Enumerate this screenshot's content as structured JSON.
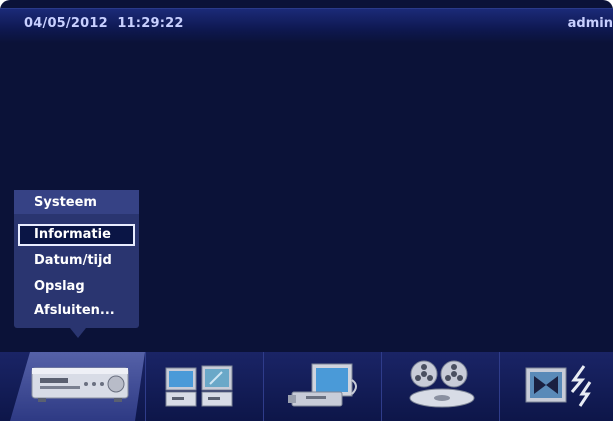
{
  "status": {
    "date": "04/05/2012",
    "time": "11:29:22",
    "user": "admin"
  },
  "menu": {
    "title": "Systeem",
    "items": [
      {
        "label": "Informatie",
        "selected": true
      },
      {
        "label": "Datum/tijd",
        "selected": false
      },
      {
        "label": "Opslag",
        "selected": false
      },
      {
        "label": "Afsluiten...",
        "selected": false
      }
    ]
  },
  "taskbar": {
    "icons": [
      {
        "name": "dvr-system-icon",
        "active": true
      },
      {
        "name": "multi-camera-display-icon",
        "active": false
      },
      {
        "name": "monitor-usb-storage-icon",
        "active": false
      },
      {
        "name": "film-reel-playback-icon",
        "active": false
      },
      {
        "name": "alarm-lightning-icon",
        "active": false
      }
    ]
  },
  "colors": {
    "background": "#0b1238",
    "menu_bg": "#2a3570",
    "text": "#ffffff"
  }
}
